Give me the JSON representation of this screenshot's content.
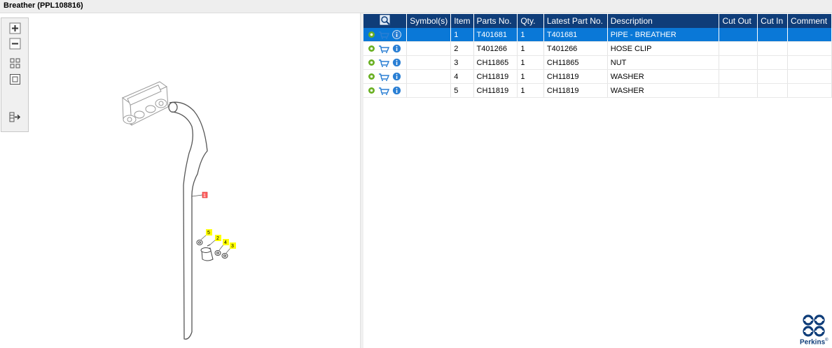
{
  "window": {
    "title": "Breather (PPL108816)"
  },
  "diagram": {
    "callouts": [
      {
        "label": "1",
        "highlighted": true
      },
      {
        "label": "2",
        "highlighted": false
      },
      {
        "label": "3",
        "highlighted": false
      },
      {
        "label": "4",
        "highlighted": false
      },
      {
        "label": "5",
        "highlighted": false
      }
    ]
  },
  "table": {
    "headers": {
      "symbols": "Symbol(s)",
      "item": "Item",
      "parts_no": "Parts No.",
      "qty": "Qty.",
      "latest_part_no": "Latest Part No.",
      "description": "Description",
      "cut_out": "Cut Out",
      "cut_in": "Cut In",
      "comment": "Comment"
    },
    "rows": [
      {
        "symbols": "",
        "item": "1",
        "parts_no": "T401681",
        "qty": "1",
        "latest_part_no": "T401681",
        "description": "PIPE - BREATHER",
        "cut_out": "",
        "cut_in": "",
        "comment": "",
        "selected": true
      },
      {
        "symbols": "",
        "item": "2",
        "parts_no": "T401266",
        "qty": "1",
        "latest_part_no": "T401266",
        "description": "HOSE CLIP",
        "cut_out": "",
        "cut_in": "",
        "comment": "",
        "selected": false
      },
      {
        "symbols": "",
        "item": "3",
        "parts_no": "CH11865",
        "qty": "1",
        "latest_part_no": "CH11865",
        "description": "NUT",
        "cut_out": "",
        "cut_in": "",
        "comment": "",
        "selected": false
      },
      {
        "symbols": "",
        "item": "4",
        "parts_no": "CH11819",
        "qty": "1",
        "latest_part_no": "CH11819",
        "description": "WASHER",
        "cut_out": "",
        "cut_in": "",
        "comment": "",
        "selected": false
      },
      {
        "symbols": "",
        "item": "5",
        "parts_no": "CH11819",
        "qty": "1",
        "latest_part_no": "CH11819",
        "description": "WASHER",
        "cut_out": "",
        "cut_in": "",
        "comment": "",
        "selected": false
      }
    ]
  },
  "brand": {
    "name": "Perkins",
    "trademark": "®"
  },
  "colors": {
    "header_bg": "#0f3d79",
    "selected_row": "#0a78d7",
    "callout_yellow": "#ffff00",
    "callout_red": "#ff6666"
  },
  "icons": [
    "zoom-in-icon",
    "zoom-out-icon",
    "fit-all-icon",
    "fit-window-icon",
    "toggle-panel-icon",
    "gear-icon",
    "cart-icon",
    "info-icon",
    "column-chooser-icon"
  ]
}
